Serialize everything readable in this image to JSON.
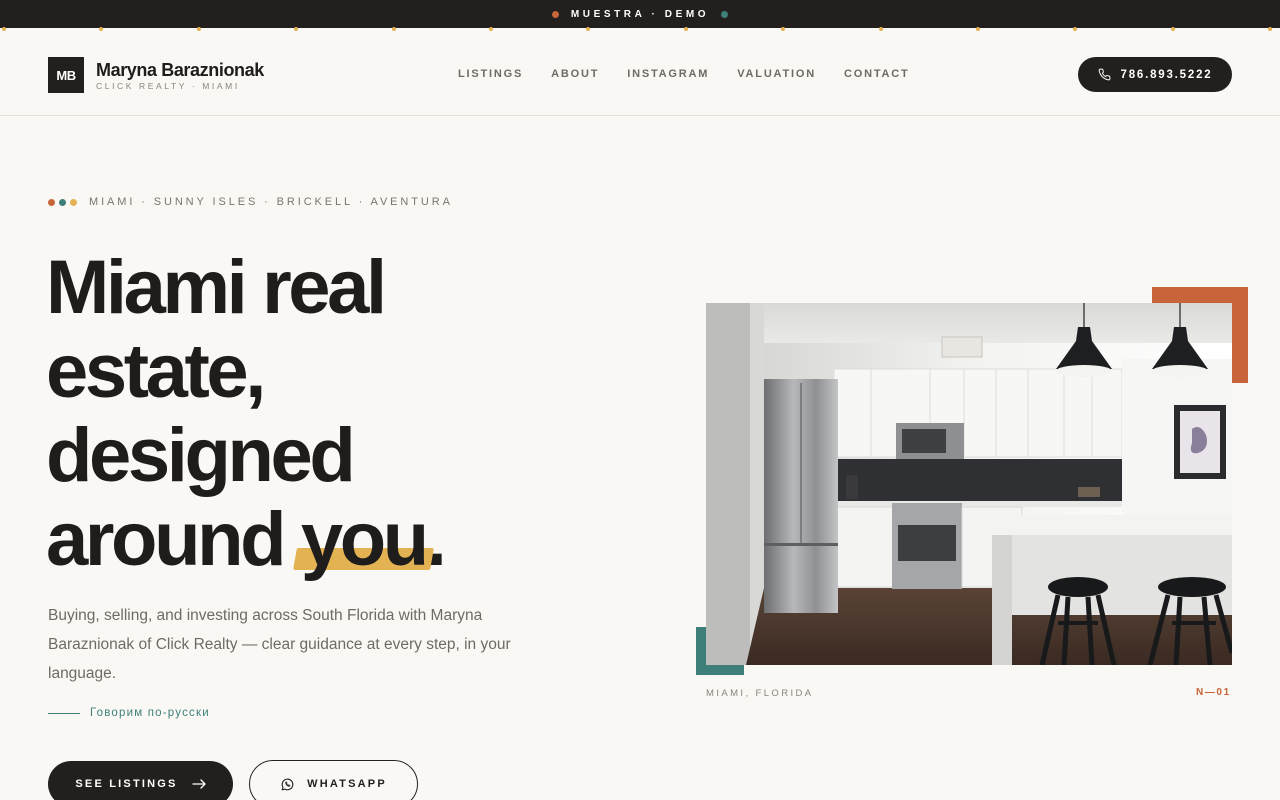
{
  "topbar": {
    "label": "MUESTRA · DEMO",
    "dot_left_color": "#c8643a",
    "dot_right_color": "#3e7f7a"
  },
  "header": {
    "logo_initials": "MB",
    "brand_name": "Maryna Baraznionak",
    "brand_sub": "CLICK REALTY · MIAMI",
    "nav": [
      "LISTINGS",
      "ABOUT",
      "INSTAGRAM",
      "VALUATION",
      "CONTACT"
    ],
    "phone": "786.893.5222",
    "phone_icon": "phone-icon"
  },
  "hero": {
    "eyebrow": "MIAMI · SUNNY ISLES · BRICKELL · AVENTURA",
    "eyebrow_dot_colors": [
      "#c8643a",
      "#3e7f7a",
      "#e2b253"
    ],
    "headline": {
      "line1": "Miami real",
      "line2": "estate,",
      "line3": "designed",
      "line4_pre": "around ",
      "line4_highlight": "you",
      "line4_post": "."
    },
    "lede": "Buying, selling, and investing across South Florida with Maryna Baraznionak of Click Realty — clear guidance at every step, in your language.",
    "russian": "Говорим по-русски",
    "cta_primary": "SEE LISTINGS",
    "cta_primary_icon": "arrow-right-icon",
    "cta_secondary": "WHATSAPP",
    "cta_secondary_icon": "whatsapp-icon"
  },
  "photo": {
    "subject": "kitchen-interior-photo",
    "caption_location": "MIAMI, FLORIDA",
    "caption_number": "N—01"
  },
  "colors": {
    "dark": "#221f1c",
    "background": "#faf8f5",
    "accent_orange": "#c8643a",
    "accent_teal": "#3e7f7a",
    "accent_yellow": "#e2b253"
  }
}
